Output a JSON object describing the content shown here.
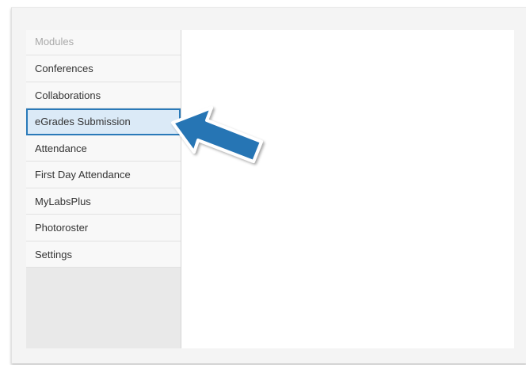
{
  "sidebar": {
    "header": "Modules",
    "items": [
      {
        "label": "Conferences",
        "name": "sidebar-item-conferences",
        "active": false
      },
      {
        "label": "Collaborations",
        "name": "sidebar-item-collaborations",
        "active": false
      },
      {
        "label": "eGrades Submission",
        "name": "sidebar-item-egrades-submission",
        "active": true
      },
      {
        "label": "Attendance",
        "name": "sidebar-item-attendance",
        "active": false
      },
      {
        "label": "First Day Attendance",
        "name": "sidebar-item-first-day-attendance",
        "active": false
      },
      {
        "label": "MyLabsPlus",
        "name": "sidebar-item-mylabsplus",
        "active": false
      },
      {
        "label": "Photoroster",
        "name": "sidebar-item-photoroster",
        "active": false
      },
      {
        "label": "Settings",
        "name": "sidebar-item-settings",
        "active": false
      }
    ]
  },
  "colors": {
    "highlight_border": "#2a7ab9",
    "highlight_fill": "#dbeaf7",
    "arrow": "#2874b4"
  },
  "annotation": {
    "icon": "pointer-arrow-icon"
  }
}
